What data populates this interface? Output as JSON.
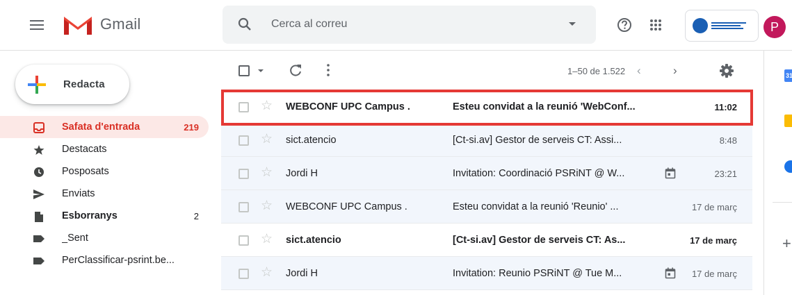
{
  "header": {
    "app_name": "Gmail",
    "search_placeholder": "Cerca al correu",
    "avatar_letter": "P"
  },
  "sidebar": {
    "compose_label": "Redacta",
    "items": [
      {
        "label": "Safata d'entrada",
        "count": "219",
        "icon": "inbox-icon",
        "state": "active"
      },
      {
        "label": "Destacats",
        "count": "",
        "icon": "star-icon",
        "state": "normal"
      },
      {
        "label": "Posposats",
        "count": "",
        "icon": "clock-icon",
        "state": "normal"
      },
      {
        "label": "Enviats",
        "count": "",
        "icon": "send-icon",
        "state": "normal"
      },
      {
        "label": "Esborranys",
        "count": "2",
        "icon": "draft-icon",
        "state": "bold"
      },
      {
        "label": "_Sent",
        "count": "",
        "icon": "label-icon",
        "state": "normal"
      },
      {
        "label": "PerClassificar-psrint.be...",
        "count": "",
        "icon": "label-icon",
        "state": "normal"
      }
    ]
  },
  "toolbar": {
    "range": "1–50 de 1.522"
  },
  "emails": [
    {
      "sender": "WEBCONF UPC Campus .",
      "subject": "Esteu convidat a la reunió 'WebConf...",
      "time": "11:02",
      "unread": true,
      "calendar": false
    },
    {
      "sender": "sict.atencio",
      "subject": "[Ct-si.av] Gestor de serveis CT: Assi...",
      "time": "8:48",
      "unread": false,
      "calendar": false
    },
    {
      "sender": "Jordi H",
      "subject": "Invitation: Coordinació PSRiNT @ W...",
      "time": "23:21",
      "unread": false,
      "calendar": true
    },
    {
      "sender": "WEBCONF UPC Campus .",
      "subject": "Esteu convidat a la reunió 'Reunio' ...",
      "time": "17 de març",
      "unread": false,
      "calendar": false
    },
    {
      "sender": "sict.atencio",
      "subject": "[Ct-si.av] Gestor de serveis CT: As...",
      "time": "17 de març",
      "unread": true,
      "calendar": false
    },
    {
      "sender": "Jordi H",
      "subject": "Invitation: Reunio PSRiNT @ Tue M...",
      "time": "17 de març",
      "unread": false,
      "calendar": true
    }
  ],
  "side_panel": {
    "calendar_day": "31"
  },
  "colors": {
    "accent_red": "#d93025",
    "highlight_border": "#e53935",
    "active_bg": "#fce8e6"
  }
}
